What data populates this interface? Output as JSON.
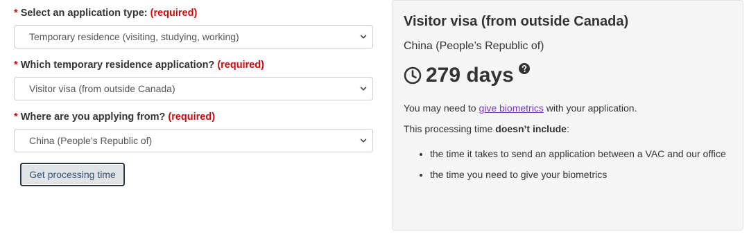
{
  "form": {
    "fields": [
      {
        "asterisk": "*",
        "label": "Select an application type:",
        "required": "(required)",
        "value": "Temporary residence (visiting, studying, working)"
      },
      {
        "asterisk": "*",
        "label": "Which temporary residence application?",
        "required": "(required)",
        "value": "Visitor visa (from outside Canada)"
      },
      {
        "asterisk": "*",
        "label": "Where are you applying from?",
        "required": "(required)",
        "value": "China (People’s Republic of)"
      }
    ],
    "submit_label": "Get processing time"
  },
  "result": {
    "title": "Visitor visa (from outside Canada)",
    "country": "China (People’s Republic of)",
    "processing_time": "279 days",
    "biometrics_prefix": "You may need to ",
    "biometrics_link": "give biometrics",
    "biometrics_suffix": " with your application.",
    "exclusion_prefix": "This processing time ",
    "exclusion_bold": "doesn’t include",
    "exclusion_suffix": ":",
    "exclusions": [
      "the time it takes to send an application between a VAC and our office",
      "the time you need to give your biometrics"
    ]
  },
  "icons": {
    "clock": "clock-icon",
    "help": "question-circle-icon",
    "chevron": "chevron-down-icon"
  },
  "colors": {
    "required": "#d3080c",
    "link": "#7834bc",
    "panel_bg": "#f5f5f5",
    "button_bg": "#e1e4e7"
  }
}
